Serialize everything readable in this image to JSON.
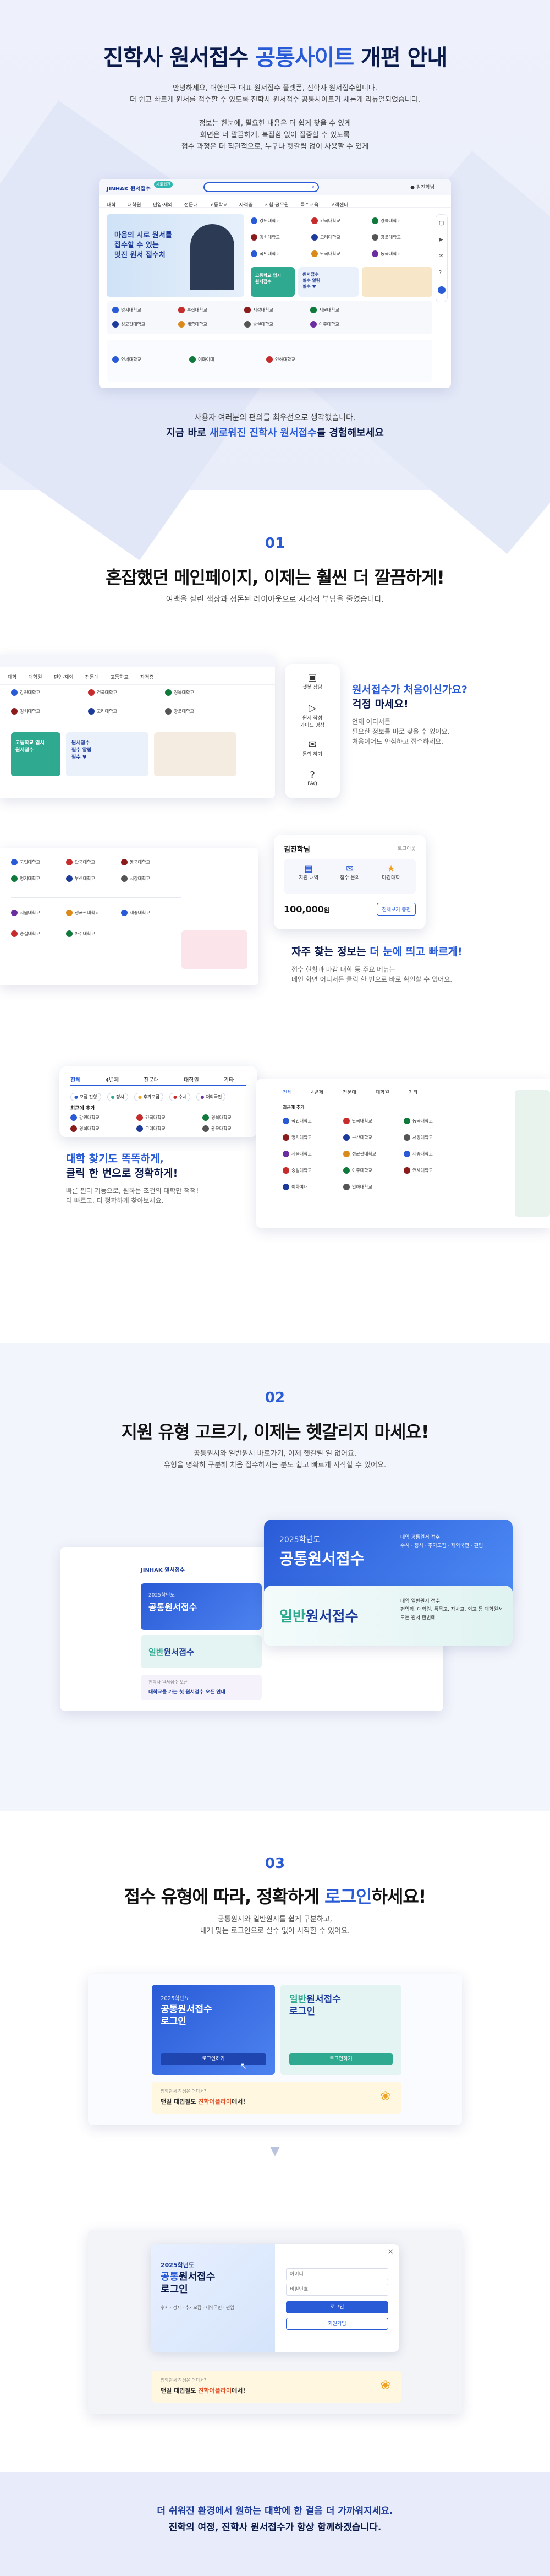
{
  "hero": {
    "title_pre": "진학사 원서접수 ",
    "title_em": "공통사이트",
    "title_post": " 개편 안내",
    "intro": [
      "안녕하세요, 대한민국 대표 원서접수 플랫폼, 진학사 원서접수입니다.",
      "더 쉽고 빠르게 원서를 접수할 수 있도록 진학사 원서접수 공통사이트가 새롭게 리뉴얼되었습니다."
    ],
    "intro2": [
      "정보는 한눈에, 필요한 내용은 더 쉽게 찾을 수 있게",
      "화면은 더 깔끔하게, 복잡함 없이 집중할 수 있도록",
      "접수 과정은 더 직관적으로, 누구나 헷갈림 없이 사용할 수 있게"
    ],
    "outro": "사용자 여러분의 편의를 최우선으로 생각했습니다.",
    "outro2_pre": "지금 바로 ",
    "outro2_em": "새로워진 진학사 원서접수",
    "outro2_post": "를 경험해보세요"
  },
  "mock": {
    "logo": "JINHAK 원서접수",
    "logo_badge": "새로워진",
    "nav": [
      "대학",
      "대학원",
      "편입·재외",
      "전문대",
      "고등학교",
      "자격증",
      "시험·공무원",
      "특수교육",
      "고객센터"
    ],
    "banner_title": "마음의 시로 원서를\n접수할 수 있는\n멋진 원서 접수처",
    "promo_title": "고등학교 입시\n원서접수",
    "promo2_title": "원서접수 \n필수 알림 \n필수 ♥",
    "side_icons": [
      "원서 상담",
      "원서 학원\n가이드 영상",
      "결재 문의",
      "FAQ"
    ],
    "universities": [
      "강원대학교",
      "건국대학교",
      "경북대학교",
      "경희대학교",
      "고려대학교",
      "광운대학교",
      "국민대학교",
      "단국대학교",
      "동국대학교",
      "명지대학교",
      "부산대학교",
      "서강대학교",
      "서울대학교",
      "성균관대학교",
      "세종대학교",
      "숭실대학교",
      "아주대학교",
      "연세대학교",
      "이화여대",
      "인하대학교"
    ]
  },
  "s1": {
    "num": "01",
    "title": "혼잡했던 메인페이지, 이제는 훨씬 더 깔끔하게!",
    "sub": "여백을 살린 색상과 정돈된 레이아웃으로 시각적 부담을 줄였습니다.",
    "c1_title_em": "원서접수가 처음이신가요?",
    "c1_title": "걱정 마세요!",
    "c1_desc": [
      "언제 어디서든",
      "필요한 정보를 바로 찾을 수 있어요.",
      "처음이어도 안심하고 접수하세요."
    ],
    "c1_icons": [
      "챗봇 상담",
      "원서 작성\n가이드 영상",
      "문의 하기",
      "FAQ"
    ],
    "c2_title_pre": "자주 찾는 정보는 ",
    "c2_title_em": "더 눈에 띄고 빠르게!",
    "c2_desc": [
      "접수 현황과 마감 대학 등 주요 메뉴는",
      "메인 화면 어디서든 클릭 한 번으로 바로 확인할 수 있어요."
    ],
    "card_name": "김진학님",
    "card_logout": "로그아웃",
    "card_icons": [
      "지원 내역",
      "접수 문의",
      "마감대학"
    ],
    "card_amount": "100,000",
    "card_amount_unit": "원",
    "card_btn": "전체보기 충전",
    "c3_title_em": "대학 찾기도 똑똑하게,",
    "c3_title": "클릭 한 번으로 정확하게!",
    "c3_desc": [
      "빠른 필터 기능으로, 원하는 조건의 대학만 척척!",
      "더 빠르고, 더 정확하게 찾아보세요."
    ],
    "filter_tabs": [
      "전체",
      "4년제",
      "전문대",
      "대학원",
      "기타"
    ],
    "filter_label": "최근에 추가",
    "filter_chips": [
      "모집 전형",
      "정시",
      "추가모집",
      "수시",
      "재외국민"
    ]
  },
  "s2": {
    "num": "02",
    "title": "지원 유형 고르기, 이제는 헷갈리지 마세요!",
    "sub": [
      "공통원서와 일반원서 바로가기, 이제 헷갈릴 일 없어요.",
      "유형을 명확히 구분해 처음 접수하시는 분도 쉽고 빠르게 시작할 수 있어요."
    ],
    "common_year": "2025학년도",
    "common_title": "공통원서접수",
    "common_desc": "대입 공통원서 접수\n수시 · 정시 · 추가모집 · 재외국민 · 편입",
    "general_pre": "일반",
    "general_title": "원서접수",
    "general_desc": "대입 일반원서 접수\n편입학, 대학원, 특목고, 자사고, 외고 등 대학원서 모든 원서 한번에",
    "banner_label": "진학사 원서접수 오픈",
    "banner_text": "대학교를 가는 첫 원서접수 오픈 안내"
  },
  "s3": {
    "num": "03",
    "title_pre": "접수 유형에 따라, 정확하게 ",
    "title_em": "로그인",
    "title_post": "하세요!",
    "sub": [
      "공통원서와 일반원서를 쉽게 구분하고,",
      "내게 맞는 로그인으로 실수 없이 시작할 수 있어요."
    ],
    "login_common_year": "2025학년도",
    "login_common_title": "공통원서접수\n로그인",
    "login_general_pre": "일반",
    "login_general_title": "원서접수\n로그인",
    "login_btn": "로그인하기",
    "ad_small": "입학원서 작성은 어디서?",
    "ad_text_pre": "맨길 대입절도 ",
    "ad_text_em": "진학어플라이",
    "ad_text_post": "에서!",
    "modal_year": "2025학년도",
    "modal_title_em": "공통",
    "modal_title": "원서접수\n로그인",
    "modal_desc": "수시 · 정시 · 추가모집 · 재외국민 · 편입",
    "modal_id_placeholder": "아이디",
    "modal_pw_placeholder": "비밀번호",
    "modal_login": "로그인",
    "modal_signup": "회원가입",
    "modal_close": "×"
  },
  "footer": {
    "line1_pre": "더 쉬워진 환경에서 원하는 대학에 한 걸음 더 가까워지세요.",
    "line2": "진학의 여정, 진학사 원서접수가 항상 함께하겠습니다."
  }
}
